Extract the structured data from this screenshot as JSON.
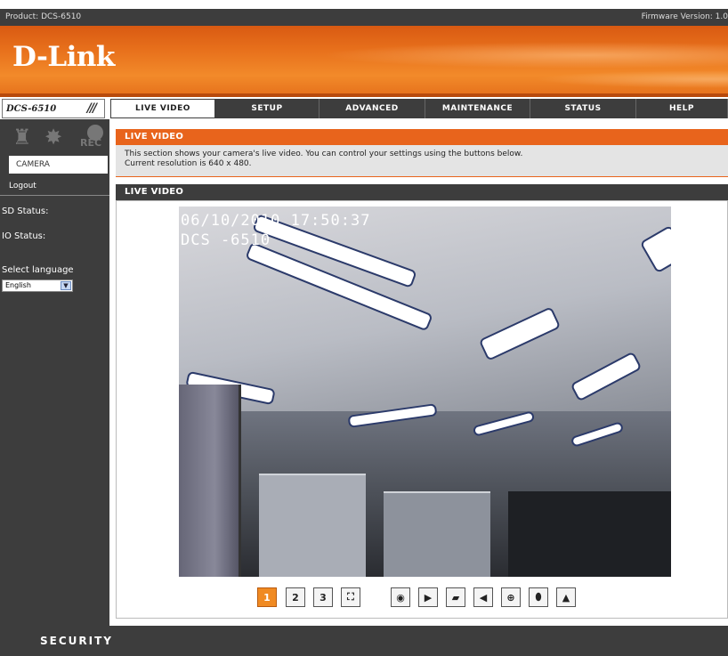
{
  "topbar": {
    "product": "Product: DCS-6510",
    "firmware": "Firmware Version: 1.0"
  },
  "brand": {
    "logo": "D-Link"
  },
  "model": {
    "name": "DCS-6510"
  },
  "nav": {
    "tabs": [
      {
        "label": "LIVE VIDEO",
        "active": true
      },
      {
        "label": "SETUP"
      },
      {
        "label": "ADVANCED"
      },
      {
        "label": "MAINTENANCE"
      },
      {
        "label": "STATUS"
      },
      {
        "label": "HELP"
      }
    ]
  },
  "sidebar": {
    "rec_label": "REC",
    "camera_button": "CAMERA",
    "logout": "Logout",
    "sd_status": "SD Status:",
    "io_status": "IO Status:",
    "select_language": "Select language",
    "language_value": "English"
  },
  "main": {
    "section_title": "LIVE VIDEO",
    "info_line1": "This section shows your camera's live video. You can control your settings using the buttons below.",
    "info_line2": "Current resolution is 640 x 480.",
    "video_title": "LIVE VIDEO"
  },
  "video": {
    "osd_datetime": "06/10/2010 17:50:37",
    "osd_camera": "DCS -6510"
  },
  "controls": {
    "buttons": [
      {
        "name": "profile-1-button",
        "label": "1"
      },
      {
        "name": "profile-2-button",
        "label": "2"
      },
      {
        "name": "profile-3-button",
        "label": "3"
      },
      {
        "name": "fullscreen-button",
        "label": "⛶"
      },
      {
        "name": "snapshot-button",
        "label": "◉"
      },
      {
        "name": "record-button",
        "label": "▶"
      },
      {
        "name": "folder-button",
        "label": "▰"
      },
      {
        "name": "speaker-button",
        "label": "◀"
      },
      {
        "name": "zoom-button",
        "label": "⊕"
      },
      {
        "name": "microphone-button",
        "label": "⬮"
      },
      {
        "name": "alarm-button",
        "label": "▲"
      }
    ]
  },
  "footer": {
    "label": "SECURITY"
  },
  "colors": {
    "accent": "#e8641c",
    "dark": "#3d3d3d"
  }
}
